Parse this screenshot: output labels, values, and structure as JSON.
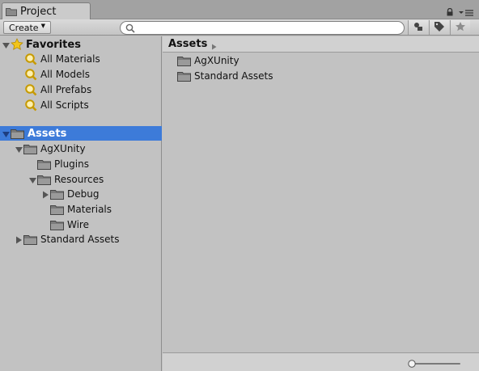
{
  "window": {
    "tab_label": "Project"
  },
  "toolbar": {
    "create_label": "Create",
    "search_placeholder": ""
  },
  "favorites": {
    "label": "Favorites",
    "items": [
      {
        "label": "All Materials"
      },
      {
        "label": "All Models"
      },
      {
        "label": "All Prefabs"
      },
      {
        "label": "All Scripts"
      }
    ]
  },
  "tree": {
    "root_label": "Assets",
    "nodes": [
      {
        "label": "AgXUnity"
      },
      {
        "label": "Plugins"
      },
      {
        "label": "Resources"
      },
      {
        "label": "Debug"
      },
      {
        "label": "Materials"
      },
      {
        "label": "Wire"
      },
      {
        "label": "Standard Assets"
      }
    ]
  },
  "main": {
    "breadcrumb": "Assets",
    "items": [
      {
        "label": "AgXUnity"
      },
      {
        "label": "Standard Assets"
      }
    ]
  },
  "colors": {
    "selection": "#3d7bd9",
    "panel": "#c2c2c2",
    "header": "#d1d1d1"
  }
}
